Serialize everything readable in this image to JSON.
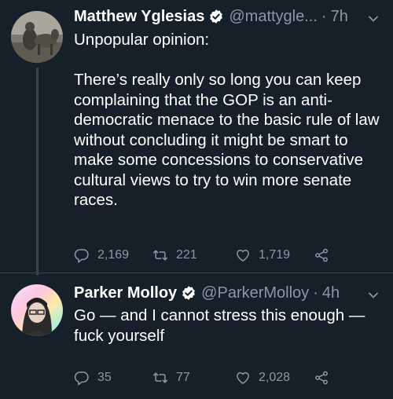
{
  "tweets": [
    {
      "author_name": "Matthew Yglesias",
      "handle": "@mattygle...",
      "separator": "·",
      "time": "7h",
      "text": "Unpopular opinion:\n\nThere’s really only so long you can keep complaining that the GOP is an anti-democratic menace to the basic rule of law without concluding it might be smart to make some concessions to conservative cultural views to try to win more senate races.",
      "replies": "2,169",
      "retweets": "221",
      "likes": "1,719"
    },
    {
      "author_name": "Parker Molloy",
      "handle": "@ParkerMolloy",
      "separator": "·",
      "time": "4h",
      "text": "Go — and I cannot stress this enough — fuck yourself",
      "replies": "35",
      "retweets": "77",
      "likes": "2,028"
    }
  ],
  "colors": {
    "background": "#15202b",
    "text": "#ffffff",
    "muted": "#8899a6",
    "verified": "#ffffff",
    "divider": "#38444d"
  },
  "icons": [
    "verified-badge-icon",
    "chevron-down-icon",
    "reply-icon",
    "retweet-icon",
    "like-icon",
    "share-icon"
  ]
}
